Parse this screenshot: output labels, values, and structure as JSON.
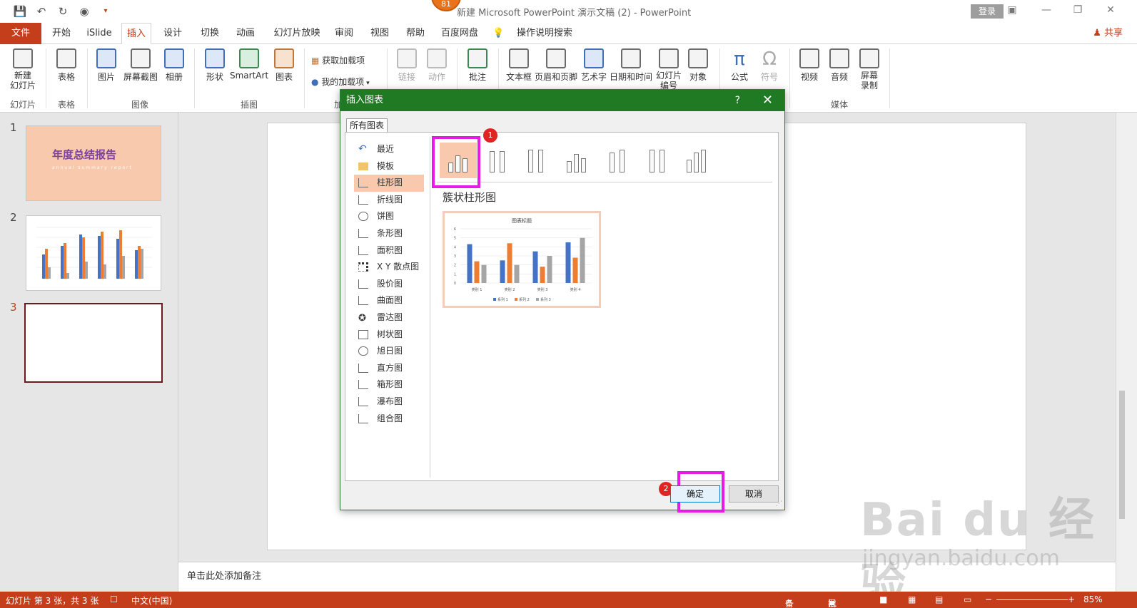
{
  "window": {
    "title": "新建 Microsoft PowerPoint 演示文稿 (2)  -  PowerPoint",
    "login": "登录",
    "badge": "81"
  },
  "tabs": [
    "文件",
    "开始",
    "iSlide",
    "插入",
    "设计",
    "切换",
    "动画",
    "幻灯片放映",
    "审阅",
    "视图",
    "帮助",
    "百度网盘",
    "操作说明搜索"
  ],
  "share": "共享",
  "ribbon": {
    "new_slide": "新建\n幻灯片",
    "table": "表格",
    "picture": "图片",
    "screenshot": "屏幕截图",
    "album": "相册",
    "shapes": "形状",
    "smartart": "SmartArt",
    "chart": "图表",
    "get_addins": "获取加载项",
    "my_addins": "我的加载项",
    "link": "链接",
    "action": "动作",
    "comment": "批注",
    "textbox": "文本框",
    "header_footer": "页眉和页脚",
    "wordart": "艺术字",
    "datetime": "日期和时间",
    "slide_number": "幻灯片\n编号",
    "object": "对象",
    "equation": "公式",
    "symbol": "符号",
    "video": "视频",
    "audio": "音频",
    "screen_record": "屏幕\n录制",
    "groups": {
      "slides": "幻灯片",
      "tables": "表格",
      "images": "图像",
      "illustrations": "插图",
      "addins": "加",
      "media": "媒体"
    }
  },
  "slides": {
    "numbers": [
      "1",
      "2",
      "3"
    ],
    "slide1_title": "年度总结报告",
    "slide1_sub": "annual summary report"
  },
  "notes_placeholder": "单击此处添加备注",
  "status": {
    "slide_info": "幻灯片 第 3 张，共 3 张",
    "language": "中文(中国)",
    "notes": "备注",
    "comments": "批注",
    "zoom": "85%"
  },
  "dialog": {
    "title": "插入图表",
    "help": "?",
    "tab": "所有图表",
    "categories": [
      "最近",
      "模板",
      "柱形图",
      "折线图",
      "饼图",
      "条形图",
      "面积图",
      "X Y 散点图",
      "股价图",
      "曲面图",
      "雷达图",
      "树状图",
      "旭日图",
      "直方图",
      "箱形图",
      "瀑布图",
      "组合图"
    ],
    "selected_category": "柱形图",
    "subtype_name": "簇状柱形图",
    "ok": "确定",
    "cancel": "取消",
    "badge1": "1",
    "badge2": "2"
  },
  "chart_data": {
    "type": "bar",
    "title": "图表标题",
    "categories": [
      "类别 1",
      "类别 2",
      "类别 3",
      "类别 4"
    ],
    "series": [
      {
        "name": "系列 1",
        "values": [
          4.3,
          2.5,
          3.5,
          4.5
        ],
        "color": "#4472c4"
      },
      {
        "name": "系列 2",
        "values": [
          2.4,
          4.4,
          1.8,
          2.8
        ],
        "color": "#ed7d31"
      },
      {
        "name": "系列 3",
        "values": [
          2.0,
          2.0,
          3.0,
          5.0
        ],
        "color": "#a5a5a5"
      }
    ],
    "ylim": [
      0,
      6
    ],
    "yticks": [
      "0",
      "1",
      "2",
      "3",
      "4",
      "5",
      "6"
    ],
    "grid": true,
    "legend": "bottom"
  },
  "watermark": {
    "main": "Bai du 经验",
    "sub": "jingyan.baidu.com"
  },
  "colors": {
    "accent": "#c43e1c",
    "dialog_title": "#207a24",
    "highlight": "#e61be6",
    "selection": "#f8c9ad"
  }
}
